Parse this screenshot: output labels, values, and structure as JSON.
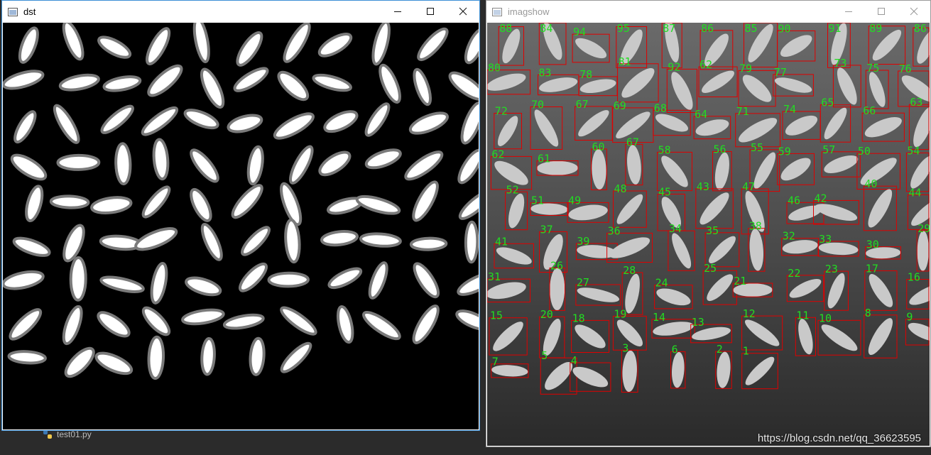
{
  "ide": {
    "tab_label": "test01.py"
  },
  "windows": {
    "dst": {
      "title": "dst"
    },
    "imagshow": {
      "title": "imagshow",
      "watermark": "https://blog.csdn.net/qq_36623595"
    }
  },
  "icons": {
    "window_icon": "app-window-icon",
    "minimize": "minimize-icon",
    "maximize": "maximize-icon",
    "close": "close-icon",
    "python": "python-file-icon"
  },
  "colors": {
    "box_stroke": "#e00000",
    "label_fill": "#22dd22",
    "grain_fill": "#ffffff",
    "grain_outline": "#7a7a7a",
    "background": "#000000"
  },
  "labels": [
    "88",
    "84",
    "94",
    "95",
    "87",
    "86",
    "85",
    "90",
    "91",
    "89",
    "86",
    "80",
    "83",
    "78",
    "81",
    "92",
    "62",
    "79",
    "77",
    "73",
    "75",
    "76",
    "72",
    "70",
    "67",
    "69",
    "68",
    "64",
    "71",
    "74",
    "65",
    "66",
    "63",
    "62",
    "61",
    "60",
    "67",
    "58",
    "56",
    "55",
    "59",
    "57",
    "50",
    "54",
    "52",
    "51",
    "49",
    "48",
    "45",
    "43",
    "47",
    "46",
    "42",
    "40",
    "44",
    "41",
    "37",
    "39",
    "36",
    "34",
    "35",
    "38",
    "32",
    "33",
    "30",
    "29",
    "31",
    "26",
    "27",
    "28",
    "24",
    "25",
    "21",
    "22",
    "23",
    "17",
    "16",
    "15",
    "20",
    "18",
    "19",
    "14",
    "13",
    "12",
    "11",
    "10",
    "8",
    "9",
    "7",
    "5",
    "4",
    "3",
    "6",
    "2",
    "1"
  ]
}
